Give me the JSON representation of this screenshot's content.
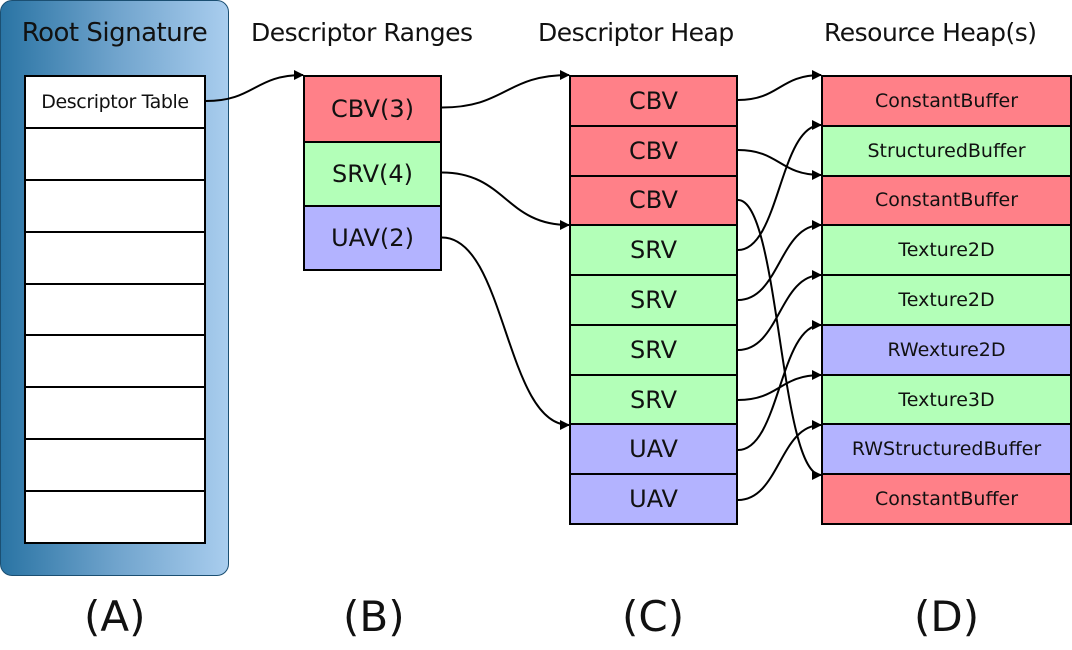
{
  "headings": {
    "root_signature": "Root Signature",
    "descriptor_ranges": "Descriptor Ranges",
    "descriptor_heap": "Descriptor Heap",
    "resource_heaps": "Resource Heap(s)"
  },
  "root_signature": {
    "entries": [
      "Descriptor Table",
      "",
      "",
      "",
      "",
      "",
      "",
      "",
      ""
    ]
  },
  "descriptor_ranges": [
    {
      "label": "CBV(3)",
      "type": "cbv"
    },
    {
      "label": "SRV(4)",
      "type": "srv"
    },
    {
      "label": "UAV(2)",
      "type": "uav"
    }
  ],
  "descriptor_heap": [
    {
      "label": "CBV",
      "type": "cbv"
    },
    {
      "label": "CBV",
      "type": "cbv"
    },
    {
      "label": "CBV",
      "type": "cbv"
    },
    {
      "label": "SRV",
      "type": "srv"
    },
    {
      "label": "SRV",
      "type": "srv"
    },
    {
      "label": "SRV",
      "type": "srv"
    },
    {
      "label": "SRV",
      "type": "srv"
    },
    {
      "label": "UAV",
      "type": "uav"
    },
    {
      "label": "UAV",
      "type": "uav"
    }
  ],
  "resource_heap": [
    {
      "label": "ConstantBuffer",
      "type": "cbv"
    },
    {
      "label": "StructuredBuffer",
      "type": "srv"
    },
    {
      "label": "ConstantBuffer",
      "type": "cbv"
    },
    {
      "label": "Texture2D",
      "type": "srv"
    },
    {
      "label": "Texture2D",
      "type": "srv"
    },
    {
      "label": "RWexture2D",
      "type": "uav"
    },
    {
      "label": "Texture3D",
      "type": "srv"
    },
    {
      "label": "RWStructuredBuffer",
      "type": "uav"
    },
    {
      "label": "ConstantBuffer",
      "type": "cbv"
    }
  ],
  "connections": {
    "table_to_range_start": 0,
    "range_to_heap_start": [
      0,
      3,
      7
    ],
    "heap_to_resource": [
      0,
      2,
      8,
      1,
      3,
      4,
      6,
      5,
      7
    ]
  },
  "colors": {
    "cbv": "#ff8088",
    "srv": "#b3ffb8",
    "uav": "#b3b3ff",
    "root_gradient_start": "#2a74a4",
    "root_gradient_end": "#a9cdee"
  },
  "section_labels": [
    "(A)",
    "(B)",
    "(C)",
    "(D)"
  ]
}
